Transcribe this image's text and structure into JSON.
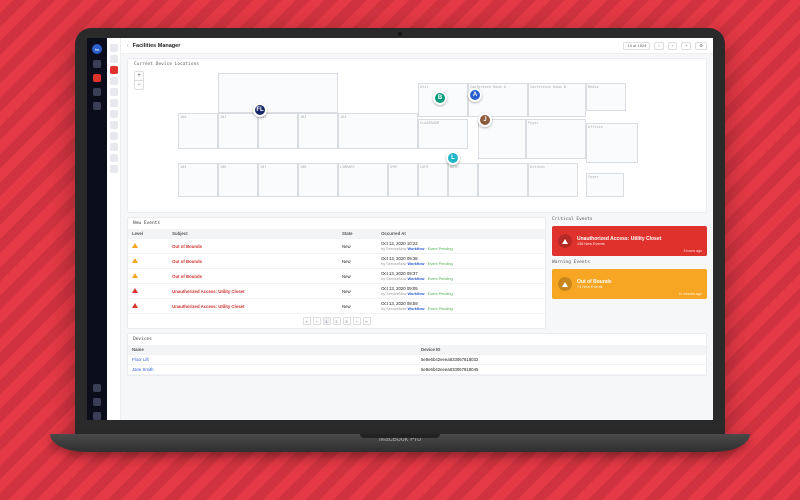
{
  "hardware": {
    "model": "MacBook Pro"
  },
  "app": {
    "title": "Facilities Manager",
    "logo_letters": "fm"
  },
  "topbar": {
    "pager": "10 of 1524",
    "action": "+"
  },
  "canvas": {
    "title": "Current Device Locations",
    "zoom_in": "+",
    "zoom_out": "−",
    "rooms": [
      "100",
      "101",
      "102",
      "103",
      "104",
      "105",
      "106",
      "107",
      "108",
      "LIBRARY",
      "GYM",
      "CLASSROOM",
      "CAFE",
      "BATH",
      "Conference Room A",
      "Conference Room B",
      "Kitchen",
      "Foyer",
      "Media",
      "Offices",
      "Util"
    ],
    "markers": [
      "FL",
      "B",
      "A",
      "J",
      "L"
    ]
  },
  "events": {
    "title": "New Events",
    "cols": [
      "Level",
      "Subject",
      "State",
      "Occurred At"
    ],
    "state_label": "New",
    "workflow_text": "Event Pending",
    "author_prefix": "by ServiceNow",
    "author_link": "Workflow",
    "rows": [
      {
        "level": "warn",
        "subject": "Out of Bounds",
        "ts": "Oct 13, 2020 10:22"
      },
      {
        "level": "warn",
        "subject": "Out of Bounds",
        "ts": "Oct 13, 2020 09:38"
      },
      {
        "level": "warn",
        "subject": "Out of Bounds",
        "ts": "Oct 13, 2020 09:37"
      },
      {
        "level": "crit",
        "subject": "Unauthorized Access: Utility Closet",
        "ts": "Oct 13, 2020 09:05"
      },
      {
        "level": "crit",
        "subject": "Unauthorized Access: Utility Closet",
        "ts": "Oct 13, 2020 08:59"
      }
    ],
    "pager": [
      "«",
      "‹",
      "1",
      "2",
      "3",
      "›",
      "»"
    ],
    "pager_current": "1"
  },
  "side": {
    "critical_heading": "Critical Events",
    "warning_heading": "Warning Events",
    "critical": {
      "title": "Unauthorized Access: Utility Closet",
      "sub": "138 New Events",
      "ago": "3 hours ago"
    },
    "warning": {
      "title": "Out of Bounds",
      "sub": "74 New Events",
      "ago": "11 minutes ago"
    }
  },
  "devices": {
    "title": "Devices",
    "cols": [
      "Name",
      "Device ID"
    ],
    "rows": [
      {
        "name": "Floor Lift",
        "id": "5e8e6b42eeea833067818032"
      },
      {
        "name": "Jane Smith",
        "id": "5e8e6b42eeea833067818045"
      }
    ]
  }
}
